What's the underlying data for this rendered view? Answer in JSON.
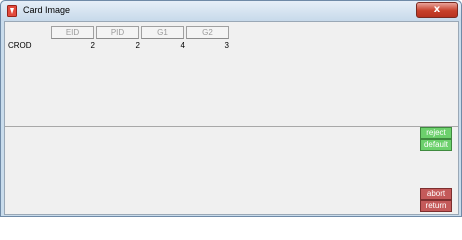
{
  "window": {
    "title": "Card Image",
    "close_glyph": "x"
  },
  "table": {
    "headers": [
      "EID",
      "PID",
      "G1",
      "G2"
    ],
    "row": {
      "label": "CROD",
      "values": [
        "2",
        "2",
        "4",
        "3"
      ]
    }
  },
  "buttons": {
    "reject": "reject",
    "default": "default",
    "abort": "abort",
    "return": "return"
  },
  "colors": {
    "green_button": "#6cd06c",
    "red_button": "#c45a5a",
    "close_button": "#c7402a"
  }
}
